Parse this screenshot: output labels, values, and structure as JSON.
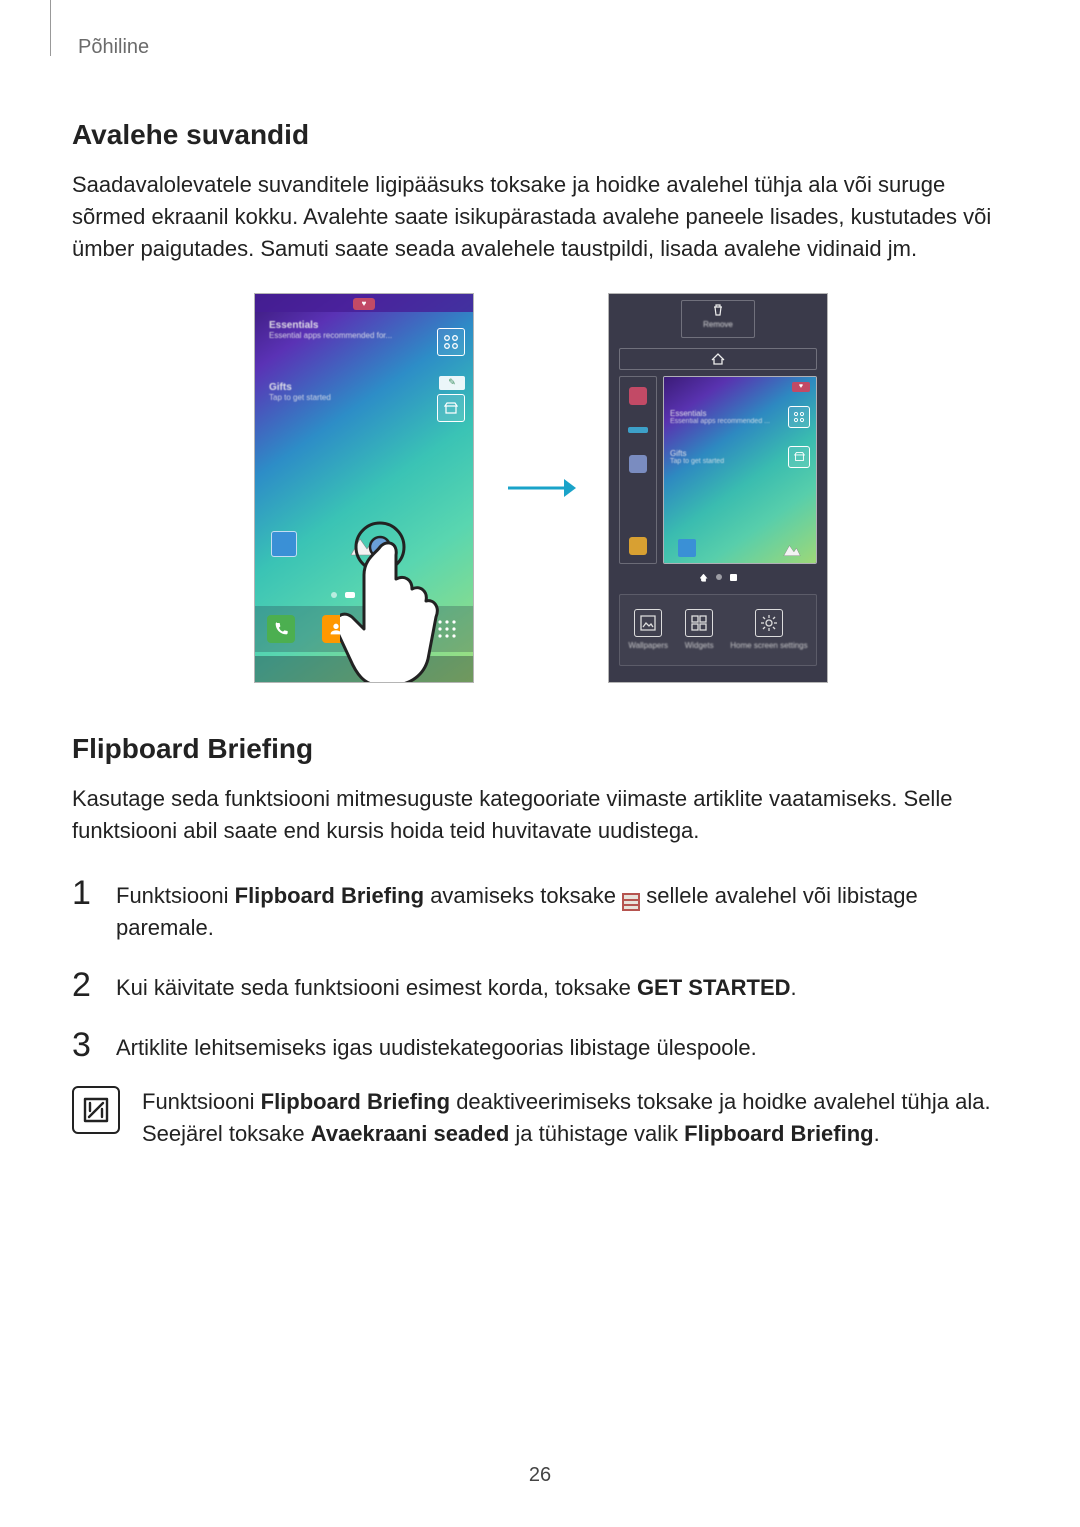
{
  "breadcrumb": "Põhiline",
  "section1": {
    "heading": "Avalehe suvandid",
    "para": "Saadavalolevatele suvanditele ligipääsuks toksake ja hoidke avalehel tühja ala või suruge sõrmed ekraanil kokku. Avalehte saate isikupärastada avalehe paneele lisades, kustutades või ümber paigutades. Samuti saate seada avalehele taustpildi, lisada avalehe vidinaid jm."
  },
  "figures": {
    "left": {
      "card1_title": "Essentials",
      "card1_sub": "Essential apps recommended for...",
      "card2_title": "Gifts",
      "card2_sub": "Tap to get started"
    },
    "right": {
      "remove_label": "Remove",
      "card1_title": "Essentials",
      "card1_sub": "Essential apps recommended ...",
      "card2_title": "Gifts",
      "card2_sub": "Tap to get started",
      "opt1": "Wallpapers",
      "opt2": "Widgets",
      "opt3": "Home screen settings"
    }
  },
  "section2": {
    "heading": "Flipboard Briefing",
    "para": "Kasutage seda funktsiooni mitmesuguste kategooriate viimaste artiklite vaatamiseks. Selle funktsiooni abil saate end kursis hoida teid huvitavate uudistega."
  },
  "steps": {
    "s1_pre": "Funktsiooni ",
    "s1_bold1": "Flipboard Briefing",
    "s1_mid": " avamiseks toksake ",
    "s1_post": " sellele avalehel või libistage paremale.",
    "s2_pre": "Kui käivitate seda funktsiooni esimest korda, toksake ",
    "s2_bold": "GET STARTED",
    "s2_post": ".",
    "s3": "Artiklite lehitsemiseks igas uudistekategoorias libistage ülespoole."
  },
  "note": {
    "line1_pre": "Funktsiooni ",
    "line1_b1": "Flipboard Briefing",
    "line1_mid": " deaktiveerimiseks toksake ja hoidke avalehel tühja ala. Seejärel toksake ",
    "line1_b2": "Avaekraani seaded",
    "line1_mid2": " ja tühistage valik ",
    "line1_b3": "Flipboard Briefing",
    "line1_post": "."
  },
  "page_number": "26",
  "nums": {
    "n1": "1",
    "n2": "2",
    "n3": "3"
  }
}
